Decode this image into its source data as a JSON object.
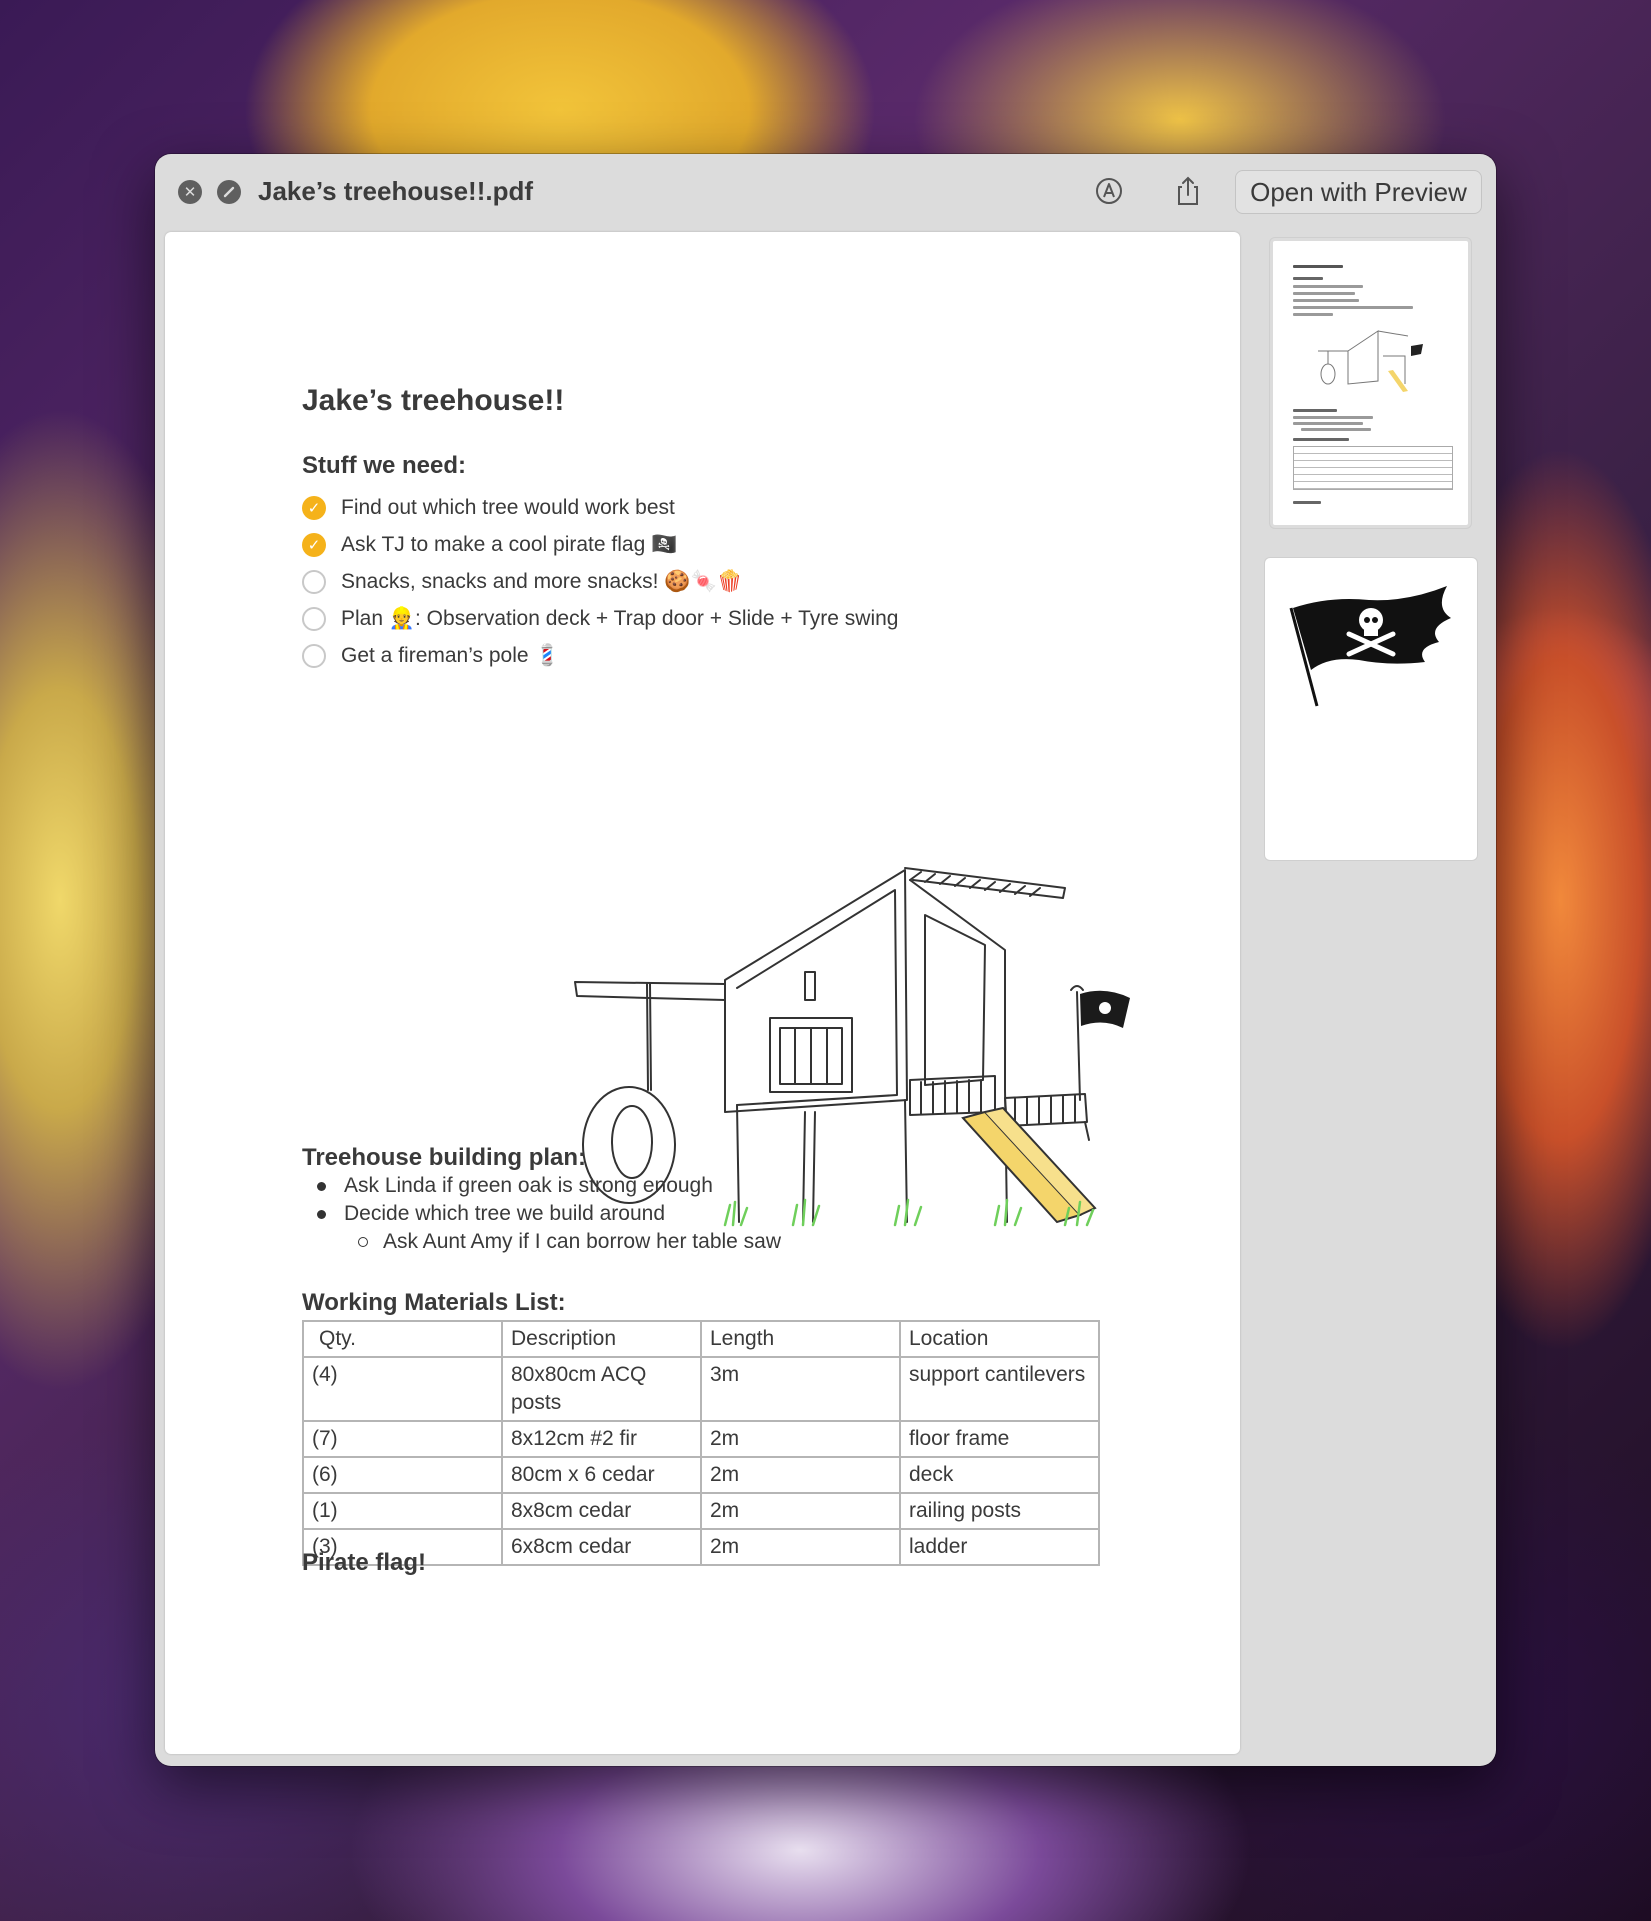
{
  "window": {
    "title": "Jake’s treehouse!!.pdf",
    "open_with_label": "Open with Preview",
    "close_icon": "close-icon",
    "slash_icon": "cancel-slash-icon",
    "markup_icon": "markup-pen-icon",
    "share_icon": "share-icon"
  },
  "doc": {
    "title": "Jake’s treehouse!!",
    "stuff_heading": "Stuff we need:",
    "checklist": [
      {
        "text": "Find out which tree would work best",
        "checked": true
      },
      {
        "text": "Ask TJ to make a cool pirate flag 🏴‍☠️",
        "checked": true
      },
      {
        "text": "Snacks, snacks and more snacks! 🍪🍬🍿",
        "checked": false
      },
      {
        "text": "Plan 👷: Observation deck + Trap door + Slide + Tyre swing",
        "checked": false
      },
      {
        "text": "Get a fireman’s pole 💈",
        "checked": false
      }
    ],
    "plan_heading": "Treehouse building plan:",
    "plan_items": [
      {
        "text": "Ask Linda if green oak is strong enough",
        "level": 1
      },
      {
        "text": "Decide which tree we build around",
        "level": 1
      },
      {
        "text": "Ask Aunt Amy if I can borrow her table saw",
        "level": 2
      }
    ],
    "materials_heading": "Working Materials List:",
    "materials_headers": [
      "Qty.",
      "Description",
      "Length",
      "Location"
    ],
    "materials_rows": [
      [
        "(4)",
        "80x80cm ACQ posts",
        "3m",
        "support cantilevers"
      ],
      [
        "(7)",
        "8x12cm #2 fir",
        "2m",
        "floor frame"
      ],
      [
        "(6)",
        "80cm x 6 cedar",
        "2m",
        "deck"
      ],
      [
        "(1)",
        "8x8cm cedar",
        "2m",
        "railing posts"
      ],
      [
        "(3)",
        "6x8cm cedar",
        "2m",
        "ladder"
      ]
    ],
    "pirate_heading": "Pirate flag!"
  },
  "colors": {
    "check_on": "#f5b21a",
    "window_bg": "#dcdcdc"
  }
}
